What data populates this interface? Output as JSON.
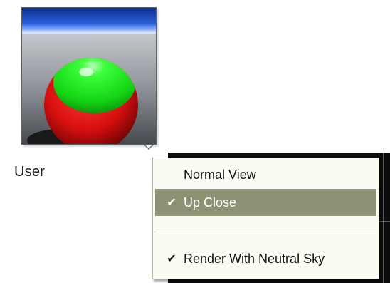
{
  "swatch": {
    "label": "User",
    "icon": "sphere-preview-icon"
  },
  "menu": {
    "items": [
      {
        "label": "Normal View",
        "checked": false,
        "selected": false
      },
      {
        "label": "Up Close",
        "checked": true,
        "selected": true
      },
      {
        "label": "Render With Neutral Sky",
        "checked": true,
        "selected": false
      }
    ],
    "check_glyph": "✔"
  },
  "colors": {
    "highlight": "#8c9273",
    "menu_bg": "#fbfbf4",
    "sphere_top": "#22ee22",
    "sphere_bottom": "#dd1111",
    "sky_blue": "#1b3fb8"
  }
}
